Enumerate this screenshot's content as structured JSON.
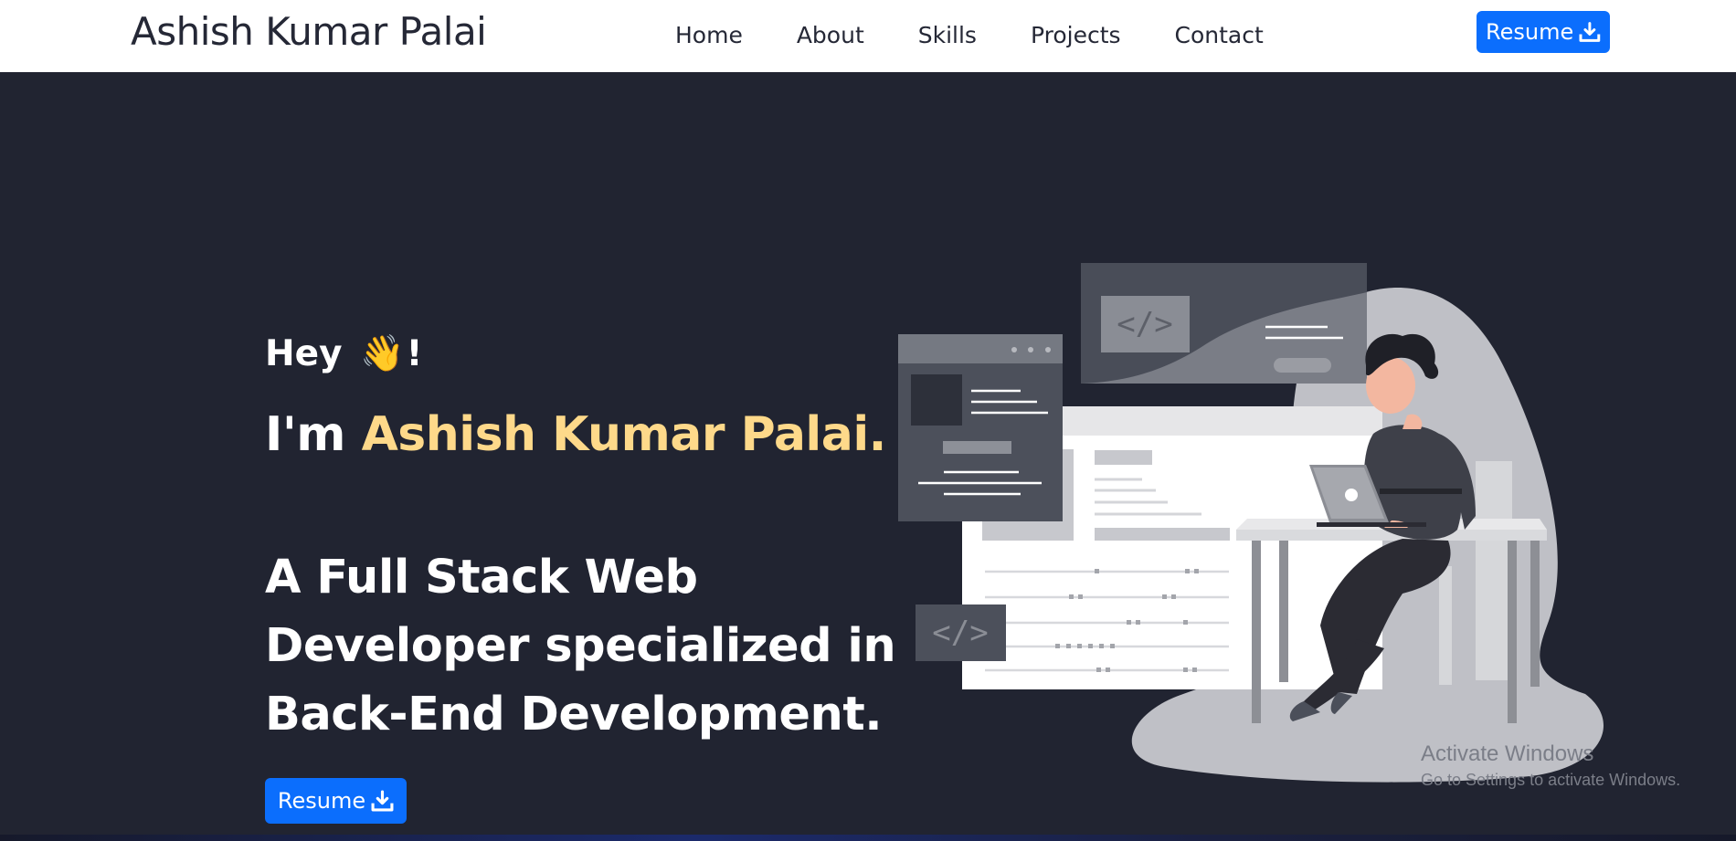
{
  "navbar": {
    "brand": "Ashish Kumar Palai",
    "links": [
      "Home",
      "About",
      "Skills",
      "Projects",
      "Contact"
    ],
    "resume_label": "Resume"
  },
  "hero": {
    "greeting_prefix": "Hey",
    "greeting_suffix": "!",
    "greeting_emoji": "👋",
    "intro_prefix": "I'm",
    "name": "Ashish Kumar Palai.",
    "tagline_lines": [
      "A Full Stack Web",
      "Developer specialized in",
      "Back-End Development."
    ],
    "resume_label": "Resume"
  },
  "watermark": {
    "title": "Activate Windows",
    "subtitle": "Go to Settings to activate Windows."
  },
  "colors": {
    "background": "#212431",
    "accent": "#0b6efd",
    "highlight": "#fed98a"
  },
  "icons": {
    "resume": "download-icon",
    "greeting": "waving-hand-icon"
  }
}
